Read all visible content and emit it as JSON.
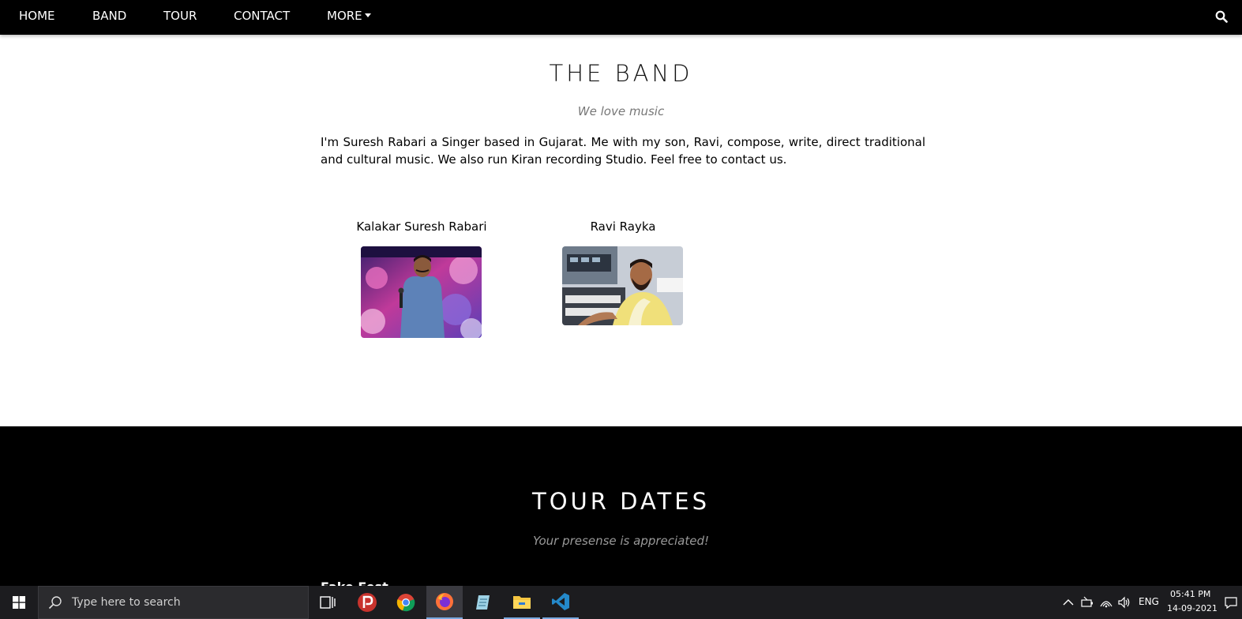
{
  "nav": {
    "items": [
      {
        "label": "HOME"
      },
      {
        "label": "BAND"
      },
      {
        "label": "TOUR"
      },
      {
        "label": "CONTACT"
      },
      {
        "label": "MORE"
      }
    ],
    "search_icon": "search-icon"
  },
  "band": {
    "title": "THE BAND",
    "subtitle": "We love music",
    "description": "I'm Suresh Rabari a Singer based in Gujarat. Me with my son, Ravi, compose, write, direct traditional and cultural music. We also run Kiran recording Studio. Feel free to contact us.",
    "members": [
      {
        "name": "Kalakar Suresh Rabari"
      },
      {
        "name": "Ravi Rayka"
      }
    ]
  },
  "tour": {
    "title": "TOUR DATES",
    "subtitle": "Your presense is appreciated!",
    "next_label": "Fake Fest"
  },
  "taskbar": {
    "search_placeholder": "Type here to search",
    "language": "ENG",
    "time": "05:41 PM",
    "date": "14-09-2021",
    "accent_color": "#7aa9e0"
  }
}
